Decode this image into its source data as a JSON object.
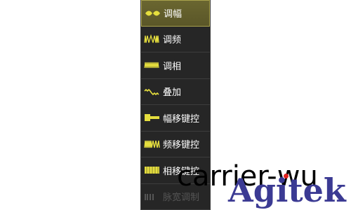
{
  "menu": {
    "accent_color": "#e5de3e",
    "items": [
      {
        "label": "调幅",
        "icon": "am-wave-icon",
        "selected": true
      },
      {
        "label": "调频",
        "icon": "fm-wave-icon"
      },
      {
        "label": "调相",
        "icon": "pm-wave-icon"
      },
      {
        "label": "叠加",
        "icon": "sum-wave-icon"
      },
      {
        "label": "幅移键控",
        "icon": "ask-wave-icon"
      },
      {
        "label": "频移键控",
        "icon": "fsk-wave-icon"
      },
      {
        "label": "相移键控",
        "icon": "psk-wave-icon"
      },
      {
        "label": "脉宽调制",
        "icon": "pwm-wave-icon",
        "disabled": true
      }
    ]
  },
  "watermark": {
    "text": "carrier-wu",
    "brand": "Agitek"
  }
}
